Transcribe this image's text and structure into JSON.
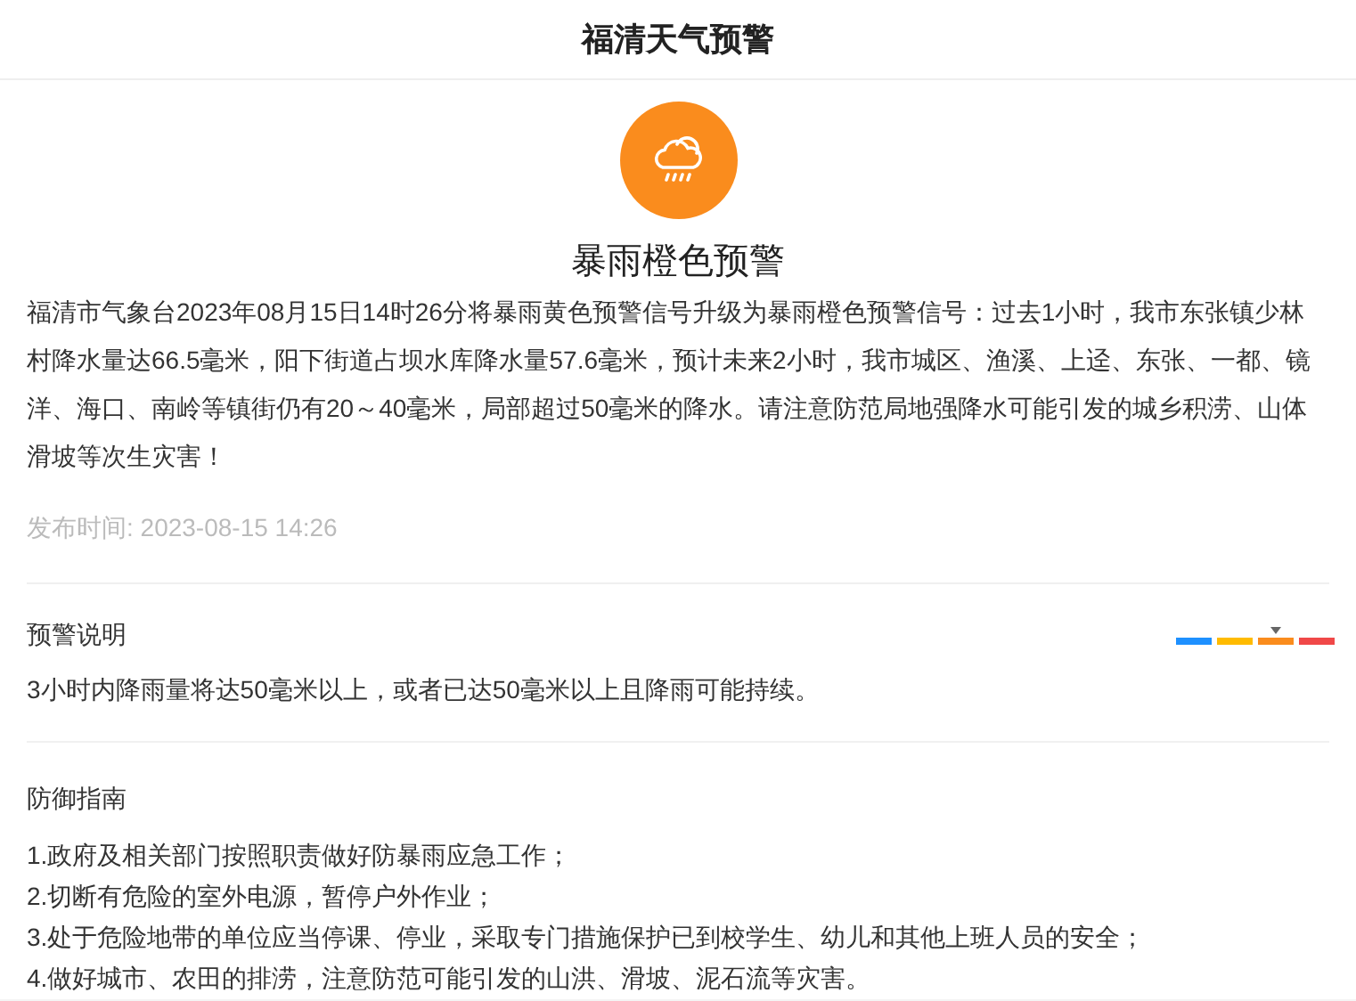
{
  "header": {
    "title": "福清天气预警"
  },
  "alert": {
    "kind": "rainstorm",
    "color": "#fa8c1d",
    "title": "暴雨橙色预警",
    "description": "福清市气象台2023年08月15日14时26分将暴雨黄色预警信号升级为暴雨橙色预警信号：过去1小时，我市东张镇少林村降水量达66.5毫米，阳下街道占坝水库降水量57.6毫米，预计未来2小时，我市城区、渔溪、上迳、东张、一都、镜洋、海口、南岭等镇街仍有20～40毫米，局部超过50毫米的降水。请注意防范局地强降水可能引发的城乡积涝、山体滑坡等次生灾害！",
    "published": "发布时间: 2023-08-15 14:26"
  },
  "explanation": {
    "heading": "预警说明",
    "levels": [
      {
        "color": "#1e90ff",
        "selected": false
      },
      {
        "color": "#ffbb00",
        "selected": false
      },
      {
        "color": "#fa8c1d",
        "selected": true
      },
      {
        "color": "#f04848",
        "selected": false
      }
    ],
    "text": "3小时内降雨量将达50毫米以上，或者已达50毫米以上且降雨可能持续。"
  },
  "guide": {
    "heading": "防御指南",
    "items": [
      "1.政府及相关部门按照职责做好防暴雨应急工作；",
      "2.切断有危险的室外电源，暂停户外作业；",
      "3.处于危险地带的单位应当停课、停业，采取专门措施保护已到校学生、幼儿和其他上班人员的安全；",
      "4.做好城市、农田的排涝，注意防范可能引发的山洪、滑坡、泥石流等灾害。"
    ]
  }
}
